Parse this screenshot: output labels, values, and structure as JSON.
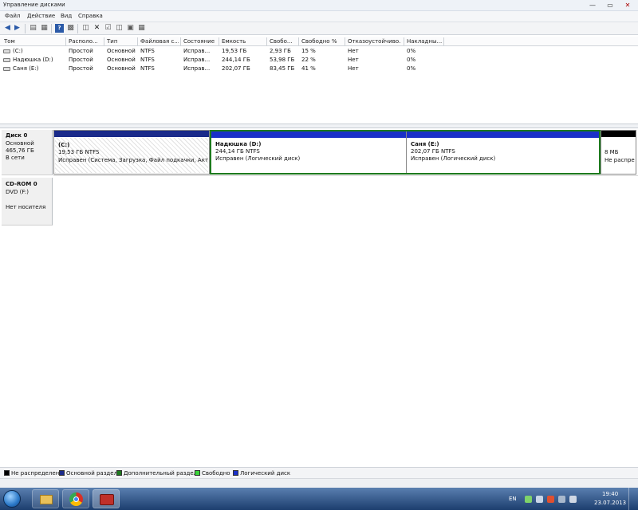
{
  "window": {
    "title": "Управление дисками",
    "controls": {
      "minimize": "—",
      "maximize": "▭",
      "close": "✕"
    }
  },
  "menu": [
    "Файл",
    "Действие",
    "Вид",
    "Справка"
  ],
  "toolbar_icons": [
    "back-icon",
    "forward-icon",
    "console-icon",
    "properties-icon",
    "help-icon",
    "refresh-icon",
    "delete-icon",
    "check-icon",
    "open-icon",
    "explore-icon",
    "properties2-icon"
  ],
  "volumes": {
    "headers": [
      "Том",
      "Располо...",
      "Тип",
      "Файловая с...",
      "Состояние",
      "Емкость",
      "Свобо...",
      "Свободно %",
      "Отказоустойчиво...",
      "Накладны..."
    ],
    "rows": [
      [
        "(C:)",
        "Простой",
        "Основной",
        "NTFS",
        "Исправ...",
        "19,53 ГБ",
        "2,93 ГБ",
        "15 %",
        "Нет",
        "0%"
      ],
      [
        "Надюшка (D:)",
        "Простой",
        "Основной",
        "NTFS",
        "Исправ...",
        "244,14 ГБ",
        "53,98 ГБ",
        "22 %",
        "Нет",
        "0%"
      ],
      [
        "Саня (E:)",
        "Простой",
        "Основной",
        "NTFS",
        "Исправ...",
        "202,07 ГБ",
        "83,45 ГБ",
        "41 %",
        "Нет",
        "0%"
      ]
    ]
  },
  "disks": [
    {
      "name": "Диск 0",
      "type": "Основной",
      "size": "465,76 ГБ",
      "status": "В сети",
      "partitions": [
        {
          "label": "(C:)",
          "size": "19,53 ГБ NTFS",
          "status": "Исправен (Система, Загрузка, Файл подкачки, Активен"
        },
        {
          "label": "Надюшка  (D:)",
          "size": "244,14 ГБ NTFS",
          "status": "Исправен (Логический диск)"
        },
        {
          "label": "Саня  (E:)",
          "size": "202,07 ГБ NTFS",
          "status": "Исправен (Логический диск)"
        },
        {
          "label": "",
          "size": "8 МБ",
          "status": "Не распре"
        }
      ]
    },
    {
      "name": "CD-ROM 0",
      "type": "DVD (F:)",
      "status": "Нет носителя"
    }
  ],
  "legend": [
    {
      "label": "Не распределен",
      "color": "#000000"
    },
    {
      "label": "Основной раздел",
      "color": "#1a2a8a"
    },
    {
      "label": "Дополнительный раздел",
      "color": "#1e7a1e"
    },
    {
      "label": "Свободно",
      "color": "#3ad43a"
    },
    {
      "label": "Логический диск",
      "color": "#1a30c8"
    }
  ],
  "taskbar": {
    "lang": "EN",
    "time": "19:40",
    "date": "23.07.2013"
  }
}
